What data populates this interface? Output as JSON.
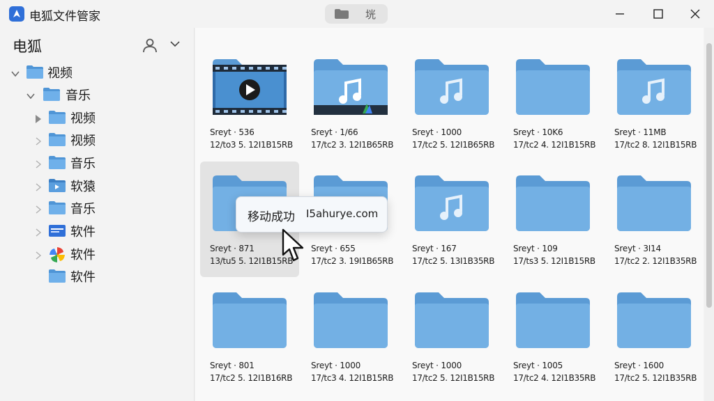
{
  "window": {
    "title": "电狐文件管家",
    "address_label": "垙"
  },
  "sidebar": {
    "title": "电狐",
    "tree": [
      {
        "label": "视频",
        "expanded": true,
        "icon": "folder-icon"
      },
      {
        "label": "音乐",
        "expanded": true,
        "icon": "folder-icon"
      },
      {
        "label": "视频",
        "expanded": false,
        "icon": "folder-icon"
      },
      {
        "label": "视频",
        "expanded": false,
        "icon": "folder-icon"
      },
      {
        "label": "音乐",
        "expanded": false,
        "icon": "folder-icon"
      },
      {
        "label": "软猿",
        "expanded": false,
        "icon": "video-folder-icon"
      },
      {
        "label": "音乐",
        "expanded": false,
        "icon": "folder-icon"
      },
      {
        "label": "软件",
        "expanded": false,
        "icon": "card-app-icon"
      },
      {
        "label": "软件",
        "expanded": false,
        "icon": "pinwheel-app-icon"
      },
      {
        "label": "软件",
        "expanded": false,
        "icon": "folder-icon"
      }
    ]
  },
  "grid": {
    "items": [
      {
        "name": "Sreyt · 536",
        "meta": "12/to3 5. 12I1B15RB",
        "type": "video",
        "selected": false
      },
      {
        "name": "Sreyt · 1/66",
        "meta": "17/tc2 3. 12I1B65RB",
        "type": "music-video",
        "selected": false
      },
      {
        "name": "Sreyt · 1000",
        "meta": "17/tc2 5. 12I1B65RB",
        "type": "music",
        "selected": false
      },
      {
        "name": "Sreyt · 10K6",
        "meta": "17/tc2 4. 12I1B15RB",
        "type": "folder",
        "selected": false
      },
      {
        "name": "Sreyt · 11MB",
        "meta": "17/tc2 8. 12I1B15RB",
        "type": "music",
        "selected": false
      },
      {
        "name": "Sreyt · 871",
        "meta": "13/tu5 5. 12I1B15RB",
        "type": "folder",
        "selected": true
      },
      {
        "name": "Sreyt · 655",
        "meta": "17/tc2 3. 19I1B65RB",
        "type": "folder",
        "selected": false
      },
      {
        "name": "Sreyt · 167",
        "meta": "17/tc2 5. 13I1B35RB",
        "type": "music",
        "selected": false
      },
      {
        "name": "Sreyt · 109",
        "meta": "17/ts3 5. 12I1B15RB",
        "type": "folder",
        "selected": false
      },
      {
        "name": "Sreyt · 3I14",
        "meta": "17/tc2 2. 12I1B35RB",
        "type": "folder",
        "selected": false
      },
      {
        "name": "Sreyt · 801",
        "meta": "17/tc2 5. 12I1B16RB",
        "type": "folder",
        "selected": false
      },
      {
        "name": "Sreyt · 1000",
        "meta": "17/tc3 4. 12I1B15RB",
        "type": "folder",
        "selected": false
      },
      {
        "name": "Sreyt · 1000",
        "meta": "17/tc2 5. 12I1B15RB",
        "type": "folder",
        "selected": false
      },
      {
        "name": "Sreyt · 1005",
        "meta": "17/tc2 4. 12I1B35RB",
        "type": "folder",
        "selected": false
      },
      {
        "name": "Sreyt · 1600",
        "meta": "17/tc2 5. 12I1B35RB",
        "type": "folder",
        "selected": false
      }
    ]
  },
  "toast": {
    "message": "移动成功",
    "url": "I5ahurye.com"
  },
  "colors": {
    "folder_back": "#5b9bd5",
    "folder_front": "#73b0e4",
    "accent": "#2f6fd8"
  }
}
